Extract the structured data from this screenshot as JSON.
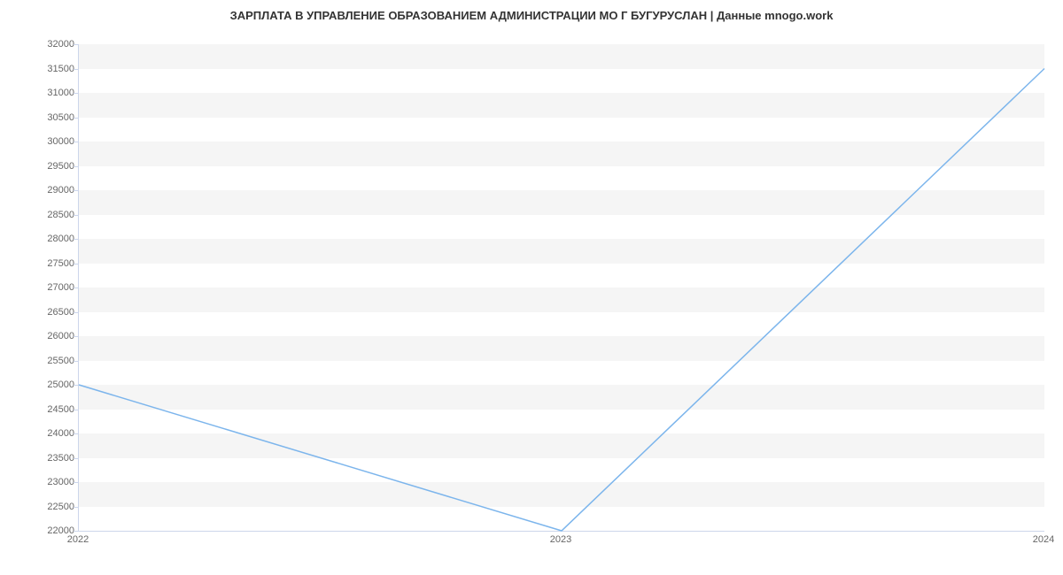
{
  "chart_data": {
    "type": "line",
    "title": "ЗАРПЛАТА В УПРАВЛЕНИЕ ОБРАЗОВАНИЕМ АДМИНИСТРАЦИИ МО Г БУГУРУСЛАН | Данные mnogo.work",
    "xlabel": "",
    "ylabel": "",
    "x": [
      "2022",
      "2023",
      "2024"
    ],
    "values": [
      25000,
      22000,
      31500
    ],
    "ylim": [
      22000,
      32000
    ],
    "y_ticks": [
      22000,
      22500,
      23000,
      23500,
      24000,
      24500,
      25000,
      25500,
      26000,
      26500,
      27000,
      27500,
      28000,
      28500,
      29000,
      29500,
      30000,
      30500,
      31000,
      31500,
      32000
    ],
    "series_color": "#7cb5ec"
  }
}
